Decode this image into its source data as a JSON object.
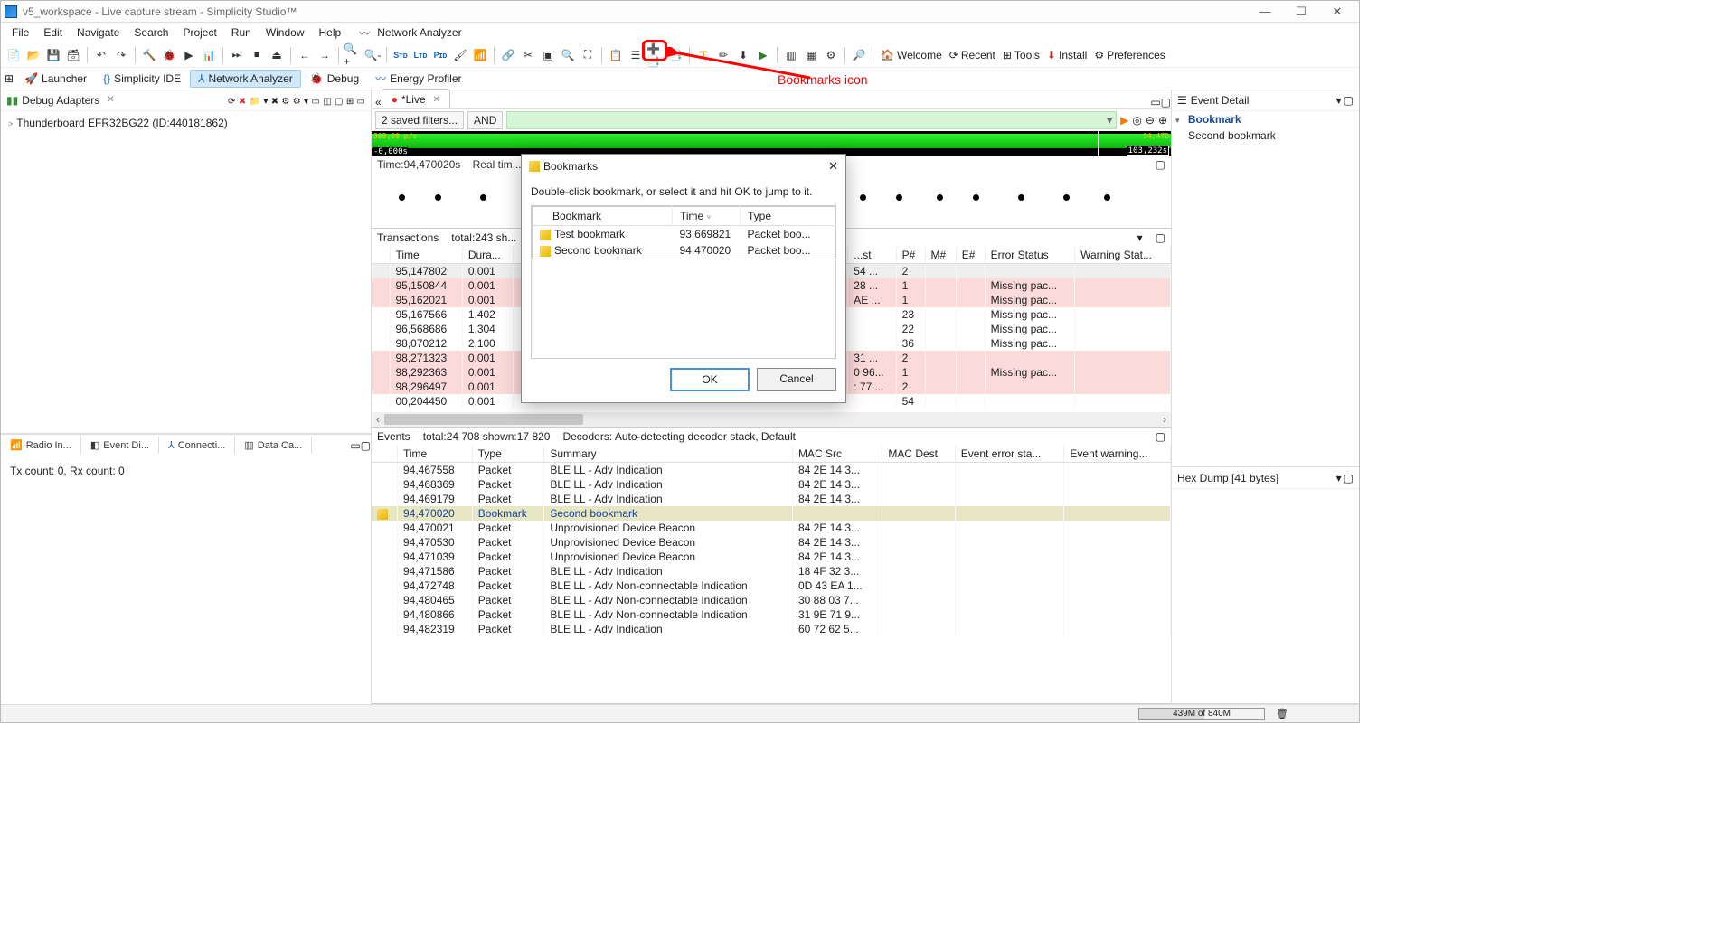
{
  "title": "v5_workspace - Live capture stream - Simplicity Studio™",
  "menus": [
    "File",
    "Edit",
    "Navigate",
    "Search",
    "Project",
    "Run",
    "Window",
    "Help"
  ],
  "menu_extra": "Network Analyzer",
  "perspectives": [
    {
      "label": "Launcher",
      "active": false
    },
    {
      "label": "Simplicity IDE",
      "active": false
    },
    {
      "label": "Network Analyzer",
      "active": true
    },
    {
      "label": "Debug",
      "active": false
    },
    {
      "label": "Energy Profiler",
      "active": false
    }
  ],
  "toolbar_right_tabs": [
    {
      "icon": "🏠",
      "label": "Welcome"
    },
    {
      "icon": "⟳",
      "label": "Recent"
    },
    {
      "icon": "⊞",
      "label": "Tools"
    },
    {
      "icon": "⬇",
      "label": "Install"
    },
    {
      "icon": "⚙",
      "label": "Preferences"
    }
  ],
  "debug_adapters": {
    "title": "Debug Adapters",
    "items": [
      "Thunderboard EFR32BG22 (ID:440181862)"
    ]
  },
  "left_tabs": [
    "Radio In...",
    "Event Di...",
    "Connecti...",
    "Data Ca..."
  ],
  "radio_info": "Tx count: 0, Rx count: 0",
  "editor_tab": "*Live",
  "filters": {
    "saved": "2 saved filters...",
    "op": "AND"
  },
  "timeline": {
    "tl_rate": "309,00 p/s",
    "tl_start": "-0,000s",
    "tr_time": "94,470",
    "tr_end": "103,232s"
  },
  "spark": {
    "time_label": "Time:94,470020s",
    "status": "Real tim..."
  },
  "transactions_title": "Transactions",
  "transactions_sub": "total:243 sh...",
  "transactions_cols": [
    "Time",
    "Dura...",
    "",
    "...st",
    "P#",
    "M#",
    "E#",
    "Error Status",
    "Warning Stat..."
  ],
  "transactions": [
    {
      "time": "95,147802",
      "dur": "0,001",
      "dst": "54 ...",
      "p": "2",
      "m": "",
      "e": "",
      "err": "",
      "warn": "",
      "cls": "gray"
    },
    {
      "time": "95,150844",
      "dur": "0,001",
      "dst": "28 ...",
      "p": "1",
      "m": "",
      "e": "",
      "err": "Missing pac...",
      "warn": "",
      "cls": "pink"
    },
    {
      "time": "95,162021",
      "dur": "0,001",
      "dst": "AE ...",
      "p": "1",
      "m": "",
      "e": "",
      "err": "Missing pac...",
      "warn": "",
      "cls": "pink"
    },
    {
      "time": "95,167566",
      "dur": "1,402",
      "dst": "",
      "p": "23",
      "m": "",
      "e": "",
      "err": "Missing pac...",
      "warn": "",
      "cls": ""
    },
    {
      "time": "96,568686",
      "dur": "1,304",
      "dst": "",
      "p": "22",
      "m": "",
      "e": "",
      "err": "Missing pac...",
      "warn": "",
      "cls": ""
    },
    {
      "time": "98,070212",
      "dur": "2,100",
      "dst": "",
      "p": "36",
      "m": "",
      "e": "",
      "err": "Missing pac...",
      "warn": "",
      "cls": ""
    },
    {
      "time": "98,271323",
      "dur": "0,001",
      "dst": "31 ...",
      "p": "2",
      "m": "",
      "e": "",
      "err": "",
      "warn": "",
      "cls": "pink"
    },
    {
      "time": "98,292363",
      "dur": "0,001",
      "dst": "0 96...",
      "p": "1",
      "m": "",
      "e": "",
      "err": "Missing pac...",
      "warn": "",
      "cls": "pink"
    },
    {
      "time": "98,296497",
      "dur": "0,001",
      "dst": ": 77 ...",
      "p": "2",
      "m": "",
      "e": "",
      "err": "",
      "warn": "",
      "cls": "pink"
    },
    {
      "time": "00,204450",
      "dur": "0,001",
      "dst": "",
      "p": "54",
      "m": "",
      "e": "",
      "err": "",
      "warn": "",
      "cls": ""
    }
  ],
  "events_title": "Events",
  "events_sub1": "total:24 708 shown:17 820",
  "events_sub2": "Decoders: Auto-detecting decoder stack, Default",
  "events_cols": [
    "Time",
    "Type",
    "Summary",
    "MAC Src",
    "MAC Dest",
    "Event error sta...",
    "Event warning..."
  ],
  "events": [
    {
      "time": "94,467558",
      "type": "Packet",
      "sum": "BLE LL - Adv Indication",
      "src": "84 2E 14 3...",
      "cls": ""
    },
    {
      "time": "94,468369",
      "type": "Packet",
      "sum": "BLE LL - Adv Indication",
      "src": "84 2E 14 3...",
      "cls": ""
    },
    {
      "time": "94,469179",
      "type": "Packet",
      "sum": "BLE LL - Adv Indication",
      "src": "84 2E 14 3...",
      "cls": ""
    },
    {
      "time": "94,470020",
      "type": "Bookmark",
      "sum": "Second bookmark",
      "src": "",
      "cls": "bookmark-row"
    },
    {
      "time": "94,470021",
      "type": "Packet",
      "sum": "Unprovisioned Device Beacon",
      "src": "84 2E 14 3...",
      "cls": ""
    },
    {
      "time": "94,470530",
      "type": "Packet",
      "sum": "Unprovisioned Device Beacon",
      "src": "84 2E 14 3...",
      "cls": ""
    },
    {
      "time": "94,471039",
      "type": "Packet",
      "sum": "Unprovisioned Device Beacon",
      "src": "84 2E 14 3...",
      "cls": ""
    },
    {
      "time": "94,471586",
      "type": "Packet",
      "sum": "BLE LL - Adv Indication",
      "src": "18 4F 32 3...",
      "cls": ""
    },
    {
      "time": "94,472748",
      "type": "Packet",
      "sum": "BLE LL - Adv Non-connectable Indication",
      "src": "0D 43 EA 1...",
      "cls": ""
    },
    {
      "time": "94,480465",
      "type": "Packet",
      "sum": "BLE LL - Adv Non-connectable Indication",
      "src": "30 88 03 7...",
      "cls": ""
    },
    {
      "time": "94,480866",
      "type": "Packet",
      "sum": "BLE LL - Adv Non-connectable Indication",
      "src": "31 9E 71 9...",
      "cls": ""
    },
    {
      "time": "94,482319",
      "type": "Packet",
      "sum": "BLE LL - Adv Indication",
      "src": "60 72 62 5...",
      "cls": ""
    }
  ],
  "detail": {
    "title": "Event Detail",
    "section": "Bookmark",
    "value": "Second bookmark"
  },
  "hexdump": "Hex Dump [41 bytes]",
  "memory": "439M of 840M",
  "dialog": {
    "title": "Bookmarks",
    "instr": "Double-click bookmark, or select it and hit OK to jump to it.",
    "cols": [
      "Bookmark",
      "Time",
      "Type"
    ],
    "rows": [
      {
        "name": "Test bookmark",
        "time": "93,669821",
        "type": "Packet boo..."
      },
      {
        "name": "Second bookmark",
        "time": "94,470020",
        "type": "Packet boo..."
      }
    ],
    "ok": "OK",
    "cancel": "Cancel"
  },
  "annotation": "Bookmarks icon"
}
